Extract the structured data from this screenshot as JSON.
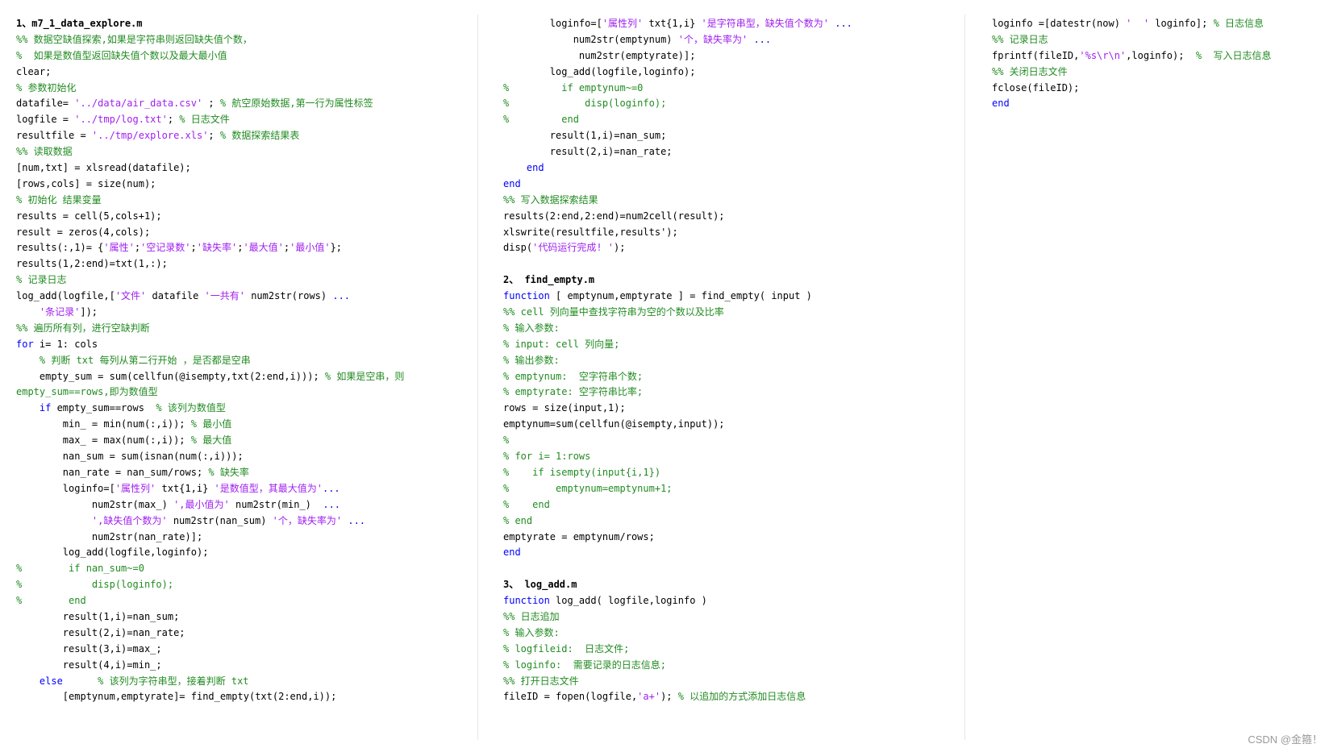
{
  "colors": {
    "text": "#000000",
    "comment": "#228b22",
    "string": "#a020f0",
    "keyword": "#0000ff"
  },
  "watermark": "CSDN @金箍！",
  "columns": [
    {
      "name": "column-left",
      "lines": [
        [
          {
            "t": "h",
            "v": "1、m7_1_data_explore.m"
          }
        ],
        [
          {
            "t": "c",
            "v": "%% 数据空缺值探索,如果是字符串则返回缺失值个数，"
          }
        ],
        [
          {
            "t": "c",
            "v": "%  如果是数值型返回缺失值个数以及最大最小值"
          }
        ],
        [
          {
            "t": "t",
            "v": "clear;"
          }
        ],
        [
          {
            "t": "c",
            "v": "% 参数初始化"
          }
        ],
        [
          {
            "t": "t",
            "v": "datafile= "
          },
          {
            "t": "s",
            "v": "'../data/air_data.csv'"
          },
          {
            "t": "t",
            "v": " ; "
          },
          {
            "t": "c",
            "v": "% 航空原始数据,第一行为属性标签"
          }
        ],
        [
          {
            "t": "t",
            "v": "logfile = "
          },
          {
            "t": "s",
            "v": "'../tmp/log.txt'"
          },
          {
            "t": "t",
            "v": "; "
          },
          {
            "t": "c",
            "v": "% 日志文件"
          }
        ],
        [
          {
            "t": "t",
            "v": "resultfile = "
          },
          {
            "t": "s",
            "v": "'../tmp/explore.xls'"
          },
          {
            "t": "t",
            "v": "; "
          },
          {
            "t": "c",
            "v": "% 数据探索结果表"
          }
        ],
        [
          {
            "t": "c",
            "v": "%% 读取数据"
          }
        ],
        [
          {
            "t": "t",
            "v": "[num,txt] = xlsread(datafile);"
          }
        ],
        [
          {
            "t": "t",
            "v": "[rows,cols] = size(num);"
          }
        ],
        [
          {
            "t": "c",
            "v": "% 初始化 结果变量"
          }
        ],
        [
          {
            "t": "t",
            "v": "results = cell(5,cols+1);"
          }
        ],
        [
          {
            "t": "t",
            "v": "result = zeros(4,cols);"
          }
        ],
        [
          {
            "t": "t",
            "v": "results(:,1)= {"
          },
          {
            "t": "s",
            "v": "'属性'"
          },
          {
            "t": "t",
            "v": ";"
          },
          {
            "t": "s",
            "v": "'空记录数'"
          },
          {
            "t": "t",
            "v": ";"
          },
          {
            "t": "s",
            "v": "'缺失率'"
          },
          {
            "t": "t",
            "v": ";"
          },
          {
            "t": "s",
            "v": "'最大值'"
          },
          {
            "t": "t",
            "v": ";"
          },
          {
            "t": "s",
            "v": "'最小值'"
          },
          {
            "t": "t",
            "v": "};"
          }
        ],
        [
          {
            "t": "t",
            "v": "results(1,2:end)=txt(1,:);"
          }
        ],
        [
          {
            "t": "c",
            "v": "% 记录日志"
          }
        ],
        [
          {
            "t": "t",
            "v": "log_add(logfile,["
          },
          {
            "t": "s",
            "v": "'文件'"
          },
          {
            "t": "t",
            "v": " datafile "
          },
          {
            "t": "s",
            "v": "'一共有'"
          },
          {
            "t": "t",
            "v": " num2str(rows) "
          },
          {
            "t": "k",
            "v": "..."
          }
        ],
        [
          {
            "t": "t",
            "v": "    "
          },
          {
            "t": "s",
            "v": "'条记录'"
          },
          {
            "t": "t",
            "v": "]);"
          }
        ],
        [
          {
            "t": "c",
            "v": "%% 遍历所有列，进行空缺判断"
          }
        ],
        [
          {
            "t": "k",
            "v": "for"
          },
          {
            "t": "t",
            "v": " i= 1: cols"
          }
        ],
        [
          {
            "t": "t",
            "v": "    "
          },
          {
            "t": "c",
            "v": "% 判断 txt 每列从第二行开始 ，是否都是空串"
          }
        ],
        [
          {
            "t": "t",
            "v": "    empty_sum = sum(cellfun(@isempty,txt(2:end,i))); "
          },
          {
            "t": "c",
            "v": "% 如果是空串，则"
          }
        ],
        [
          {
            "t": "c",
            "v": "empty_sum==rows,即为数值型"
          }
        ],
        [
          {
            "t": "t",
            "v": "    "
          },
          {
            "t": "k",
            "v": "if"
          },
          {
            "t": "t",
            "v": " empty_sum==rows  "
          },
          {
            "t": "c",
            "v": "% 该列为数值型"
          }
        ],
        [
          {
            "t": "t",
            "v": "        min_ = min(num(:,i)); "
          },
          {
            "t": "c",
            "v": "% 最小值"
          }
        ],
        [
          {
            "t": "t",
            "v": "        max_ = max(num(:,i)); "
          },
          {
            "t": "c",
            "v": "% 最大值"
          }
        ],
        [
          {
            "t": "t",
            "v": "        nan_sum = sum(isnan(num(:,i)));"
          }
        ],
        [
          {
            "t": "t",
            "v": "        nan_rate = nan_sum/rows; "
          },
          {
            "t": "c",
            "v": "% 缺失率"
          }
        ],
        [
          {
            "t": "t",
            "v": "        loginfo=["
          },
          {
            "t": "s",
            "v": "'属性列'"
          },
          {
            "t": "t",
            "v": " txt{1,i} "
          },
          {
            "t": "s",
            "v": "'是数值型，其最大值为'"
          },
          {
            "t": "k",
            "v": "..."
          }
        ],
        [
          {
            "t": "t",
            "v": "             num2str(max_) "
          },
          {
            "t": "s",
            "v": "',最小值为'"
          },
          {
            "t": "t",
            "v": " num2str(min_)  "
          },
          {
            "t": "k",
            "v": "..."
          }
        ],
        [
          {
            "t": "t",
            "v": "             "
          },
          {
            "t": "s",
            "v": "',缺失值个数为'"
          },
          {
            "t": "t",
            "v": " num2str(nan_sum) "
          },
          {
            "t": "s",
            "v": "'个，缺失率为'"
          },
          {
            "t": "t",
            "v": " "
          },
          {
            "t": "k",
            "v": "..."
          }
        ],
        [
          {
            "t": "t",
            "v": "             num2str(nan_rate)];"
          }
        ],
        [
          {
            "t": "t",
            "v": "        log_add(logfile,loginfo);"
          }
        ],
        [
          {
            "t": "c",
            "v": "%        if nan_sum~=0"
          }
        ],
        [
          {
            "t": "c",
            "v": "%            disp(loginfo);"
          }
        ],
        [
          {
            "t": "c",
            "v": "%        end"
          }
        ],
        [
          {
            "t": "t",
            "v": "        result(1,i)=nan_sum;"
          }
        ],
        [
          {
            "t": "t",
            "v": "        result(2,i)=nan_rate;"
          }
        ],
        [
          {
            "t": "t",
            "v": "        result(3,i)=max_;"
          }
        ],
        [
          {
            "t": "t",
            "v": "        result(4,i)=min_;"
          }
        ],
        [
          {
            "t": "t",
            "v": "    "
          },
          {
            "t": "k",
            "v": "else"
          },
          {
            "t": "t",
            "v": "      "
          },
          {
            "t": "c",
            "v": "% 该列为字符串型，接着判断 txt"
          }
        ],
        [
          {
            "t": "t",
            "v": "        [emptynum,emptyrate]= find_empty(txt(2:end,i));"
          }
        ]
      ]
    },
    {
      "name": "column-middle",
      "lines": [
        [
          {
            "t": "t",
            "v": "        loginfo=["
          },
          {
            "t": "s",
            "v": "'属性列'"
          },
          {
            "t": "t",
            "v": " txt{1,i} "
          },
          {
            "t": "s",
            "v": "'是字符串型，缺失值个数为'"
          },
          {
            "t": "t",
            "v": " "
          },
          {
            "t": "k",
            "v": "..."
          }
        ],
        [
          {
            "t": "t",
            "v": "            num2str(emptynum) "
          },
          {
            "t": "s",
            "v": "'个，缺失率为'"
          },
          {
            "t": "t",
            "v": " "
          },
          {
            "t": "k",
            "v": "..."
          }
        ],
        [
          {
            "t": "t",
            "v": "             num2str(emptyrate)];"
          }
        ],
        [
          {
            "t": "t",
            "v": "        log_add(logfile,loginfo);"
          }
        ],
        [
          {
            "t": "c",
            "v": "%         if emptynum~=0"
          }
        ],
        [
          {
            "t": "c",
            "v": "%             disp(loginfo);"
          }
        ],
        [
          {
            "t": "c",
            "v": "%         end"
          }
        ],
        [
          {
            "t": "t",
            "v": "        result(1,i)=nan_sum;"
          }
        ],
        [
          {
            "t": "t",
            "v": "        result(2,i)=nan_rate;"
          }
        ],
        [
          {
            "t": "t",
            "v": "    "
          },
          {
            "t": "k",
            "v": "end"
          }
        ],
        [
          {
            "t": "k",
            "v": "end"
          }
        ],
        [
          {
            "t": "c",
            "v": "%% 写入数据探索结果"
          }
        ],
        [
          {
            "t": "t",
            "v": "results(2:end,2:end)=num2cell(result);"
          }
        ],
        [
          {
            "t": "t",
            "v": "xlswrite(resultfile,results');"
          }
        ],
        [
          {
            "t": "t",
            "v": "disp("
          },
          {
            "t": "s",
            "v": "'代码运行完成! '"
          },
          {
            "t": "t",
            "v": ");"
          }
        ],
        [
          {
            "t": "t",
            "v": ""
          }
        ],
        [
          {
            "t": "h",
            "v": "2、 find_empty.m"
          }
        ],
        [
          {
            "t": "k",
            "v": "function"
          },
          {
            "t": "t",
            "v": " [ emptynum,emptyrate ] = find_empty( input )"
          }
        ],
        [
          {
            "t": "c",
            "v": "%% cell 列向量中查找字符串为空的个数以及比率"
          }
        ],
        [
          {
            "t": "c",
            "v": "% 输入参数:"
          }
        ],
        [
          {
            "t": "c",
            "v": "% input: cell 列向量;"
          }
        ],
        [
          {
            "t": "c",
            "v": "% 输出参数:"
          }
        ],
        [
          {
            "t": "c",
            "v": "% emptynum:  空字符串个数;"
          }
        ],
        [
          {
            "t": "c",
            "v": "% emptyrate: 空字符串比率;"
          }
        ],
        [
          {
            "t": "t",
            "v": "rows = size(input,1);"
          }
        ],
        [
          {
            "t": "t",
            "v": "emptynum=sum(cellfun(@isempty,input));"
          }
        ],
        [
          {
            "t": "c",
            "v": "%"
          }
        ],
        [
          {
            "t": "c",
            "v": "% for i= 1:rows"
          }
        ],
        [
          {
            "t": "c",
            "v": "%    if isempty(input{i,1})"
          }
        ],
        [
          {
            "t": "c",
            "v": "%        emptynum=emptynum+1;"
          }
        ],
        [
          {
            "t": "c",
            "v": "%    end"
          }
        ],
        [
          {
            "t": "c",
            "v": "% end"
          }
        ],
        [
          {
            "t": "t",
            "v": "emptyrate = emptynum/rows;"
          }
        ],
        [
          {
            "t": "k",
            "v": "end"
          }
        ],
        [
          {
            "t": "t",
            "v": ""
          }
        ],
        [
          {
            "t": "h",
            "v": "3、 log_add.m"
          }
        ],
        [
          {
            "t": "k",
            "v": "function"
          },
          {
            "t": "t",
            "v": " log_add( logfile,loginfo )"
          }
        ],
        [
          {
            "t": "c",
            "v": "%% 日志追加"
          }
        ],
        [
          {
            "t": "c",
            "v": "% 输入参数:"
          }
        ],
        [
          {
            "t": "c",
            "v": "% logfileid:  日志文件;"
          }
        ],
        [
          {
            "t": "c",
            "v": "% loginfo:  需要记录的日志信息;"
          }
        ],
        [
          {
            "t": "c",
            "v": "%% 打开日志文件"
          }
        ],
        [
          {
            "t": "t",
            "v": "fileID = fopen(logfile,"
          },
          {
            "t": "s",
            "v": "'a+'"
          },
          {
            "t": "t",
            "v": "); "
          },
          {
            "t": "c",
            "v": "% 以追加的方式添加日志信息"
          }
        ]
      ]
    },
    {
      "name": "column-right",
      "lines": [
        [
          {
            "t": "t",
            "v": "loginfo =[datestr(now) "
          },
          {
            "t": "s",
            "v": "'  '"
          },
          {
            "t": "t",
            "v": " loginfo]; "
          },
          {
            "t": "c",
            "v": "% 日志信息"
          }
        ],
        [
          {
            "t": "c",
            "v": "%% 记录日志"
          }
        ],
        [
          {
            "t": "t",
            "v": "fprintf(fileID,"
          },
          {
            "t": "s",
            "v": "'%s\\r\\n'"
          },
          {
            "t": "t",
            "v": ",loginfo);  "
          },
          {
            "t": "c",
            "v": "%  写入日志信息"
          }
        ],
        [
          {
            "t": "c",
            "v": "%% 关闭日志文件"
          }
        ],
        [
          {
            "t": "t",
            "v": "fclose(fileID);"
          }
        ],
        [
          {
            "t": "k",
            "v": "end"
          }
        ]
      ]
    }
  ]
}
